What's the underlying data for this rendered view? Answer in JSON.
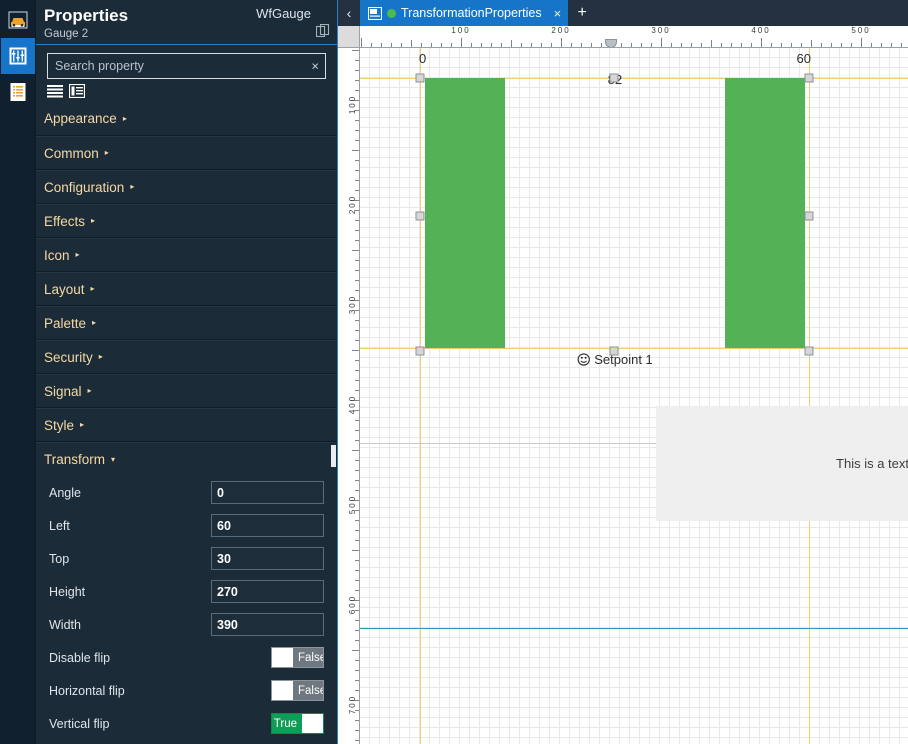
{
  "rail": {
    "items": [
      {
        "name": "vehicle-icon",
        "label": "Devices",
        "active": false
      },
      {
        "name": "properties-icon",
        "label": "Properties",
        "active": true
      },
      {
        "name": "list-icon",
        "label": "Project tree",
        "active": false
      }
    ]
  },
  "properties": {
    "title": "Properties",
    "subtitle": "Gauge 2",
    "app_name": "WfGauge",
    "copy_icon": "copy-icon",
    "search": {
      "value": "",
      "placeholder": "Search property",
      "clear_label": "×"
    },
    "view_modes": [
      {
        "name": "list-view-icon",
        "label": "Flat list"
      },
      {
        "name": "grouped-view-icon",
        "label": "Grouped list"
      }
    ],
    "categories": [
      {
        "label": "Appearance",
        "expanded": false,
        "marker": "▸"
      },
      {
        "label": "Common",
        "expanded": false,
        "marker": "▸"
      },
      {
        "label": "Configuration",
        "expanded": false,
        "marker": "▸"
      },
      {
        "label": "Effects",
        "expanded": false,
        "marker": "▸"
      },
      {
        "label": "Icon",
        "expanded": false,
        "marker": "▸"
      },
      {
        "label": "Layout",
        "expanded": false,
        "marker": "▸"
      },
      {
        "label": "Palette",
        "expanded": false,
        "marker": "▸"
      },
      {
        "label": "Security",
        "expanded": false,
        "marker": "▸"
      },
      {
        "label": "Signal",
        "expanded": false,
        "marker": "▸"
      },
      {
        "label": "Style",
        "expanded": false,
        "marker": "▸"
      },
      {
        "label": "Transform",
        "expanded": true,
        "marker": "▾"
      }
    ],
    "transform_fields": [
      {
        "label": "Angle",
        "type": "text",
        "value": "0"
      },
      {
        "label": "Left",
        "type": "text",
        "value": "60"
      },
      {
        "label": "Top",
        "type": "text",
        "value": "30"
      },
      {
        "label": "Height",
        "type": "text",
        "value": "270"
      },
      {
        "label": "Width",
        "type": "text",
        "value": "390"
      },
      {
        "label": "Disable flip",
        "type": "toggle",
        "value": "False"
      },
      {
        "label": "Horizontal flip",
        "type": "toggle",
        "value": "False"
      },
      {
        "label": "Vertical flip",
        "type": "toggle",
        "value": "True"
      }
    ]
  },
  "editor": {
    "back_arrow": "‹",
    "tab": {
      "label": "TransformationProperties",
      "doc_icon": "document-icon",
      "status_dot": "modified-dot",
      "close_label": "×"
    },
    "add_tab_label": "+",
    "ruler_h": {
      "labels": [
        "100",
        "200",
        "300",
        "400",
        "500"
      ],
      "marker_position": "250"
    },
    "ruler_v": {
      "labels": [
        "100",
        "200",
        "300",
        "400",
        "500",
        "600",
        "700"
      ]
    },
    "canvas": {
      "gauge": {
        "min_label": "0",
        "max_label": "60",
        "value_label": "82",
        "setpoint_label": "Setpoint 1",
        "setpoint_icon": "setpoint-icon",
        "fill_color": "#55b155"
      },
      "text_element": {
        "text": "This is a text",
        "background": "#efefef"
      }
    }
  },
  "colors": {
    "panel_bg": "#1c2b38",
    "rail_bg": "#10202e",
    "accent_blue": "#1675c8",
    "category_text": "#f5d9a4",
    "toggle_on": "#0f9d58",
    "toggle_off": "#6f7880",
    "guide_yellow": "#f0cf70",
    "guide_cyan": "#2e9cb0"
  }
}
